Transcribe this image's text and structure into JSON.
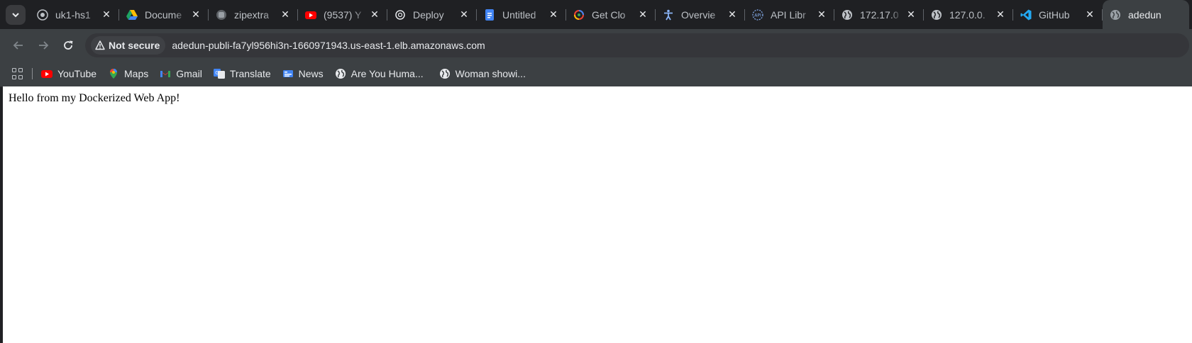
{
  "tabs": [
    {
      "title": "uk1-hs1",
      "icon": "globe-outline-icon"
    },
    {
      "title": "Docume",
      "icon": "google-drive-icon"
    },
    {
      "title": "zipextra",
      "icon": "app-outline-icon"
    },
    {
      "title": "(9537) Y",
      "icon": "youtube-icon"
    },
    {
      "title": "Deploy",
      "icon": "openai-icon"
    },
    {
      "title": "Untitled",
      "icon": "google-docs-icon"
    },
    {
      "title": "Get Clo",
      "icon": "google-cloud-icon"
    },
    {
      "title": "Overvie",
      "icon": "accessibility-icon"
    },
    {
      "title": "API Libr",
      "icon": "api-icon"
    },
    {
      "title": "172.17.0",
      "icon": "globe-icon"
    },
    {
      "title": "127.0.0.",
      "icon": "globe-icon"
    },
    {
      "title": "GitHub",
      "icon": "vscode-icon"
    },
    {
      "title": "adedun",
      "icon": "globe-icon",
      "active": true
    }
  ],
  "toolbar": {
    "security_chip": "Not secure",
    "url": "adedun-publi-fa7yl956hi3n-1660971943.us-east-1.elb.amazonaws.com"
  },
  "bookmarks": [
    {
      "label": "YouTube",
      "icon": "youtube-icon"
    },
    {
      "label": "Maps",
      "icon": "google-maps-icon"
    },
    {
      "label": "Gmail",
      "icon": "gmail-icon"
    },
    {
      "label": "Translate",
      "icon": "google-translate-icon"
    },
    {
      "label": "News",
      "icon": "google-news-icon"
    },
    {
      "label": "Are You Huma...",
      "icon": "globe-icon"
    },
    {
      "label": "Woman showi...",
      "icon": "globe-icon"
    }
  ],
  "page": {
    "body_text": "Hello from my Dockerized Web App!"
  },
  "colors": {
    "tabstrip_bg": "#1f2023",
    "toolbar_bg": "#3c4043",
    "omnibox_bg": "#35363a",
    "text_light": "#e8eaed",
    "page_bg": "#ffffff"
  }
}
